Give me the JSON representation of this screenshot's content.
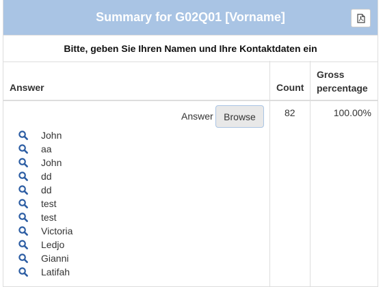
{
  "header": {
    "title": "Summary for G02Q01 [Vorname]",
    "pdf_icon": "pdf-file-icon"
  },
  "question_text": "Bitte, geben Sie Ihren Namen und Ihre Kontaktdaten ein",
  "table": {
    "columns": {
      "answer": "Answer",
      "count": "Count",
      "gross": "Gross percentage"
    },
    "row": {
      "answer_label": "Answer",
      "browse_label": "Browse",
      "count": "82",
      "gross": "100.00%"
    }
  },
  "responses": [
    "John",
    "aa",
    "John",
    "dd",
    "dd",
    "test",
    "test",
    "Victoria",
    "Ledjo",
    "Gianni",
    "Latifah"
  ],
  "colors": {
    "header_bg": "#a9c4e4",
    "icon": "#2c5da3"
  }
}
